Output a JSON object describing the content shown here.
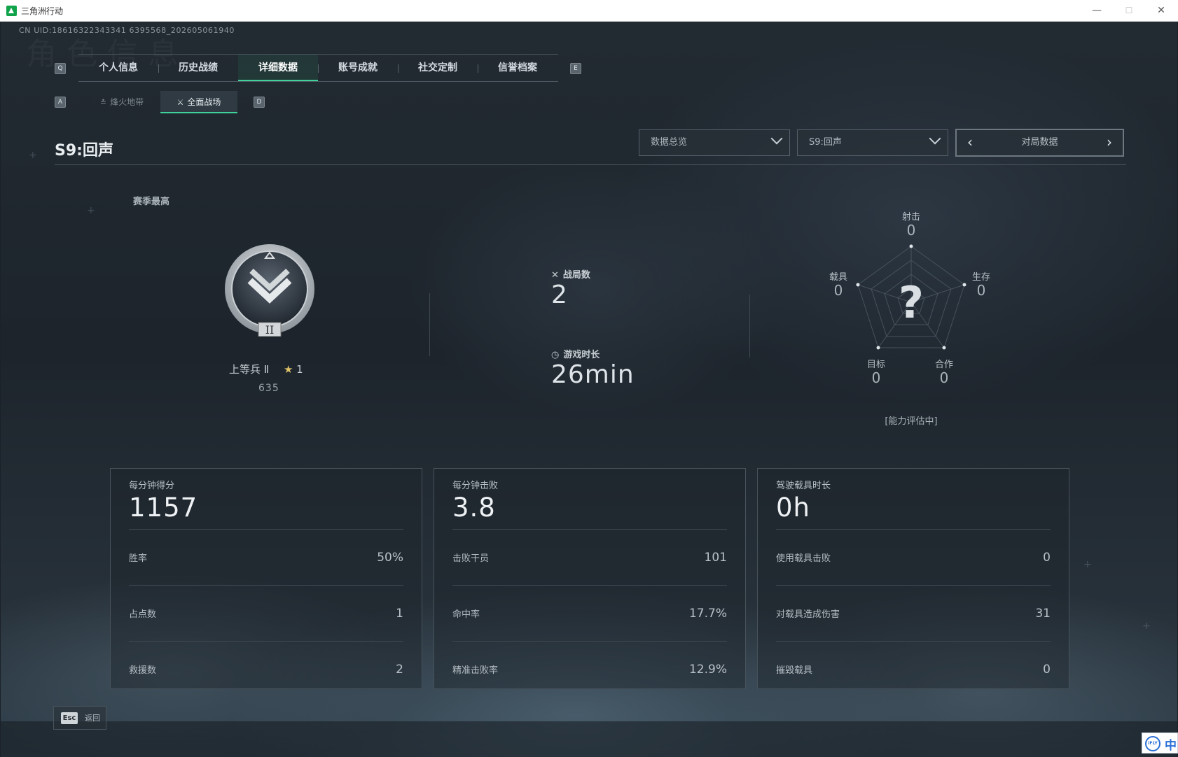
{
  "window": {
    "title": "三角洲行动",
    "min": "—",
    "max": "☐",
    "close": "✕"
  },
  "uid": "CN UID:18616322343341 6395568_202605061940",
  "tabs": {
    "left_key": "Q",
    "right_key": "E",
    "items": [
      {
        "label": "个人信息",
        "active": false
      },
      {
        "label": "历史战绩",
        "active": false
      },
      {
        "label": "详细数据",
        "active": true
      },
      {
        "label": "账号成就",
        "active": false
      },
      {
        "label": "社交定制",
        "active": false
      },
      {
        "label": "信誉档案",
        "active": false
      }
    ]
  },
  "subtabs": {
    "left_key": "A",
    "right_key": "D",
    "items": [
      {
        "label": "烽火地带",
        "active": false,
        "icon": "firezone-icon"
      },
      {
        "label": "全面战场",
        "active": true,
        "icon": "battlefield-icon"
      }
    ]
  },
  "season_title": "S9:回声",
  "dropdowns": [
    {
      "value": "数据总览"
    },
    {
      "value": "S9:回声"
    }
  ],
  "pager": {
    "label": "对局数据"
  },
  "season_best": {
    "label": "赛季最高",
    "rank_name": "上等兵 Ⅱ",
    "stars": "1",
    "score": "635",
    "badge_numeral": "II"
  },
  "summary": {
    "matches_label": "战局数",
    "matches_value": "2",
    "playtime_label": "游戏时长",
    "playtime_value": "26min"
  },
  "radar": {
    "center": "?",
    "status": "[能力评估中]",
    "axes": [
      {
        "label": "射击",
        "value": "0"
      },
      {
        "label": "生存",
        "value": "0"
      },
      {
        "label": "合作",
        "value": "0"
      },
      {
        "label": "目标",
        "value": "0"
      },
      {
        "label": "载具",
        "value": "0"
      }
    ]
  },
  "cards": [
    {
      "title": "每分钟得分",
      "main": "1157",
      "rows": [
        {
          "label": "胜率",
          "value": "50%"
        },
        {
          "label": "占点数",
          "value": "1"
        },
        {
          "label": "救援数",
          "value": "2"
        }
      ]
    },
    {
      "title": "每分钟击败",
      "main": "3.8",
      "rows": [
        {
          "label": "击败干员",
          "value": "101"
        },
        {
          "label": "命中率",
          "value": "17.7%"
        },
        {
          "label": "精准击败率",
          "value": "12.9%"
        }
      ]
    },
    {
      "title": "驾驶载具时长",
      "main": "0h",
      "rows": [
        {
          "label": "使用载具击败",
          "value": "0"
        },
        {
          "label": "对载具造成伤害",
          "value": "31"
        },
        {
          "label": "摧毁载具",
          "value": "0"
        }
      ]
    }
  ],
  "footer": {
    "esc_key": "Esc",
    "back_label": "返回"
  },
  "ime": {
    "logo": "iFLY",
    "char": "中"
  },
  "colors": {
    "accent": "#3fd19a",
    "app_icon": "#10a34a"
  }
}
